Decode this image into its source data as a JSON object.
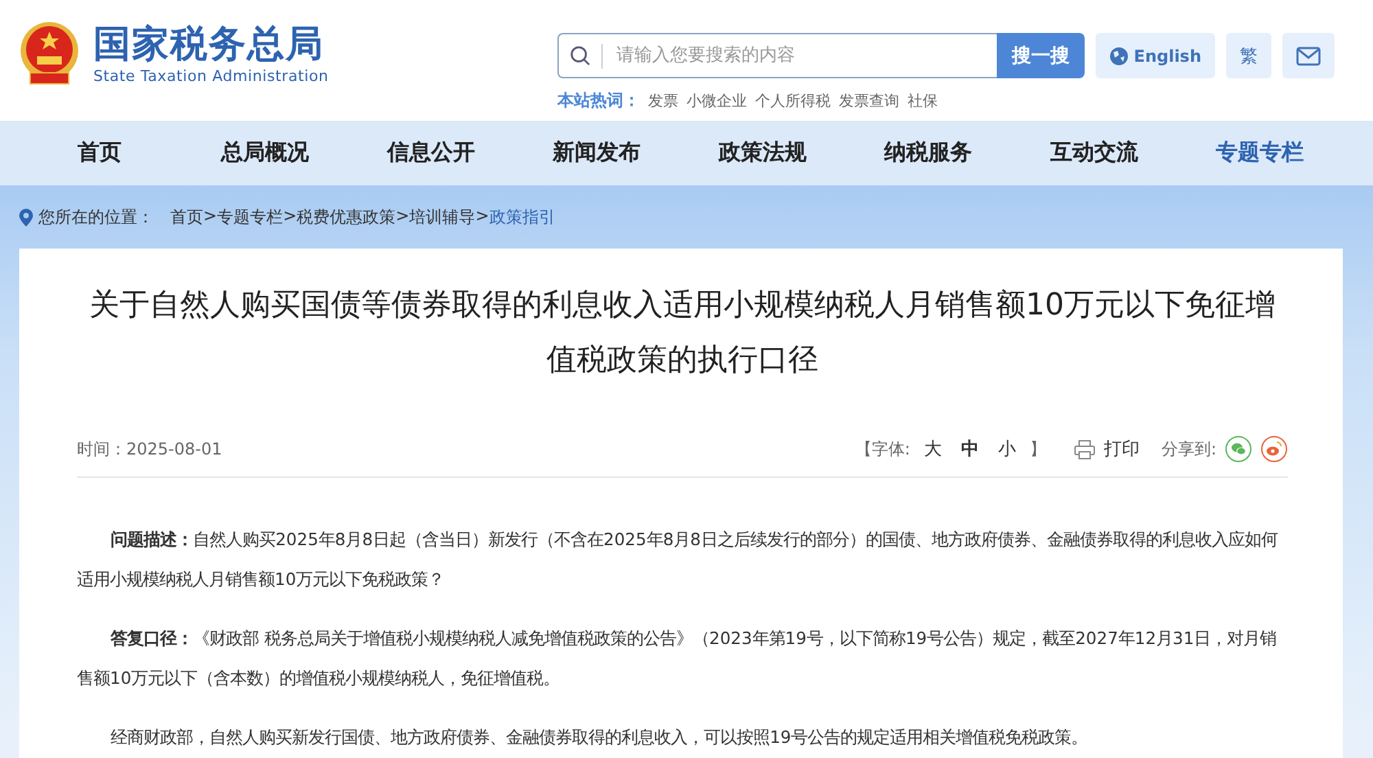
{
  "header": {
    "title": "国家税务总局",
    "subtitle": "State Taxation Administration",
    "search": {
      "placeholder": "请输入您要搜索的内容",
      "button": "搜一搜"
    },
    "english": "English",
    "traditional": "繁",
    "hot_words": {
      "label": "本站热词：",
      "items": [
        "发票",
        "小微企业",
        "个人所得税",
        "发票查询",
        "社保"
      ]
    }
  },
  "nav": [
    {
      "label": "首页",
      "selected": false
    },
    {
      "label": "总局概况",
      "selected": false
    },
    {
      "label": "信息公开",
      "selected": false
    },
    {
      "label": "新闻发布",
      "selected": false
    },
    {
      "label": "政策法规",
      "selected": false
    },
    {
      "label": "纳税服务",
      "selected": false
    },
    {
      "label": "互动交流",
      "selected": false
    },
    {
      "label": "专题专栏",
      "selected": true
    }
  ],
  "breadcrumb": {
    "label": "您所在的位置：",
    "separator": ">",
    "items": [
      {
        "label": "首页",
        "current": false
      },
      {
        "label": "专题专栏",
        "current": false
      },
      {
        "label": "税费优惠政策",
        "current": false
      },
      {
        "label": "培训辅导",
        "current": false
      },
      {
        "label": "政策指引",
        "current": true
      }
    ]
  },
  "article": {
    "title": "关于自然人购买国债等债券取得的利息收入适用小规模纳税人月销售额10万元以下免征增值税政策的执行口径",
    "date": "时间：2025-08-01",
    "font_size": {
      "open": "【字体:",
      "close": "】",
      "options": [
        {
          "label": "大",
          "selected": false
        },
        {
          "label": "中",
          "selected": true
        },
        {
          "label": "小",
          "selected": false
        }
      ]
    },
    "print": "打印",
    "share": "分享到:",
    "paragraphs": [
      "**问题描述：**自然人购买2025年8月8日起（含当日）新发行（不含在2025年8月8日之后续发行的部分）的国债、地方政府债券、金融债券取得的利息收入应如何适用小规模纳税人月销售额10万元以下免税政策？",
      "**答复口径：**《财政部 税务总局关于增值税小规模纳税人减免增值税政策的公告》（2023年第19号，以下简称19号公告）规定，截至2027年12月31日，对月销售额10万元以下（含本数）的增值税小规模纳税人，免征增值税。",
      "经商财政部，自然人购买新发行国债、地方政府债券、金融债券取得的利息收入，可以按照19号公告的规定适用相关增值税免税政策。"
    ]
  }
}
